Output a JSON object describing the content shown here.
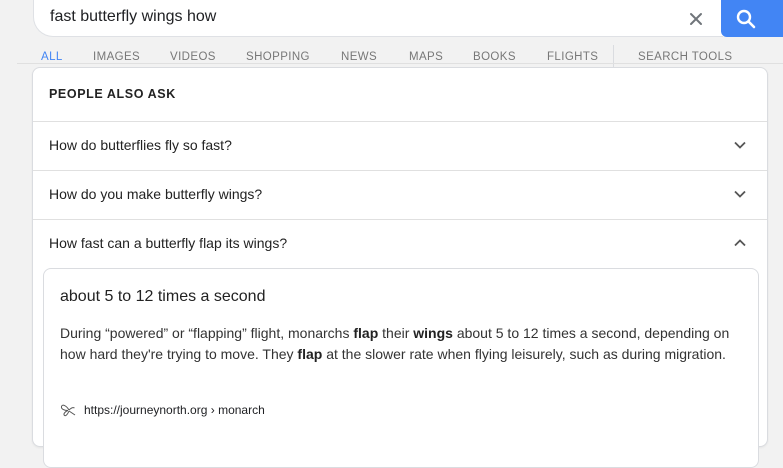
{
  "search": {
    "query": "fast butterfly wings how",
    "clear_icon": "close-icon",
    "search_icon": "search-icon",
    "accent": "#4285f4"
  },
  "tabs": [
    {
      "label": "ALL",
      "active": true
    },
    {
      "label": "IMAGES",
      "active": false
    },
    {
      "label": "VIDEOS",
      "active": false
    },
    {
      "label": "SHOPPING",
      "active": false
    },
    {
      "label": "NEWS",
      "active": false
    },
    {
      "label": "MAPS",
      "active": false
    },
    {
      "label": "BOOKS",
      "active": false
    },
    {
      "label": "FLIGHTS",
      "active": false
    },
    {
      "label": "SEARCH TOOLS",
      "active": false
    }
  ],
  "people_also_ask": {
    "heading": "PEOPLE ALSO ASK",
    "questions": [
      {
        "text": "How do butterflies fly so fast?",
        "expanded": false
      },
      {
        "text": "How do you make butterfly wings?",
        "expanded": false
      },
      {
        "text": "How fast can a butterfly flap its wings?",
        "expanded": true
      }
    ],
    "answer": {
      "title": "about 5 to 12 times a second",
      "body": [
        {
          "t": "During “powered” or “flapping” flight, monarchs ",
          "b": false
        },
        {
          "t": "flap",
          "b": true
        },
        {
          "t": " their ",
          "b": false
        },
        {
          "t": "wings",
          "b": true
        },
        {
          "t": " about 5 to 12 times a second, depending on how hard they're trying to move. They ",
          "b": false
        },
        {
          "t": "flap",
          "b": true
        },
        {
          "t": " at the slower rate when flying leisurely, such as during migration.",
          "b": false
        }
      ],
      "source": "https://journeynorth.org › monarch",
      "source_icon": "butterfly-icon"
    }
  }
}
